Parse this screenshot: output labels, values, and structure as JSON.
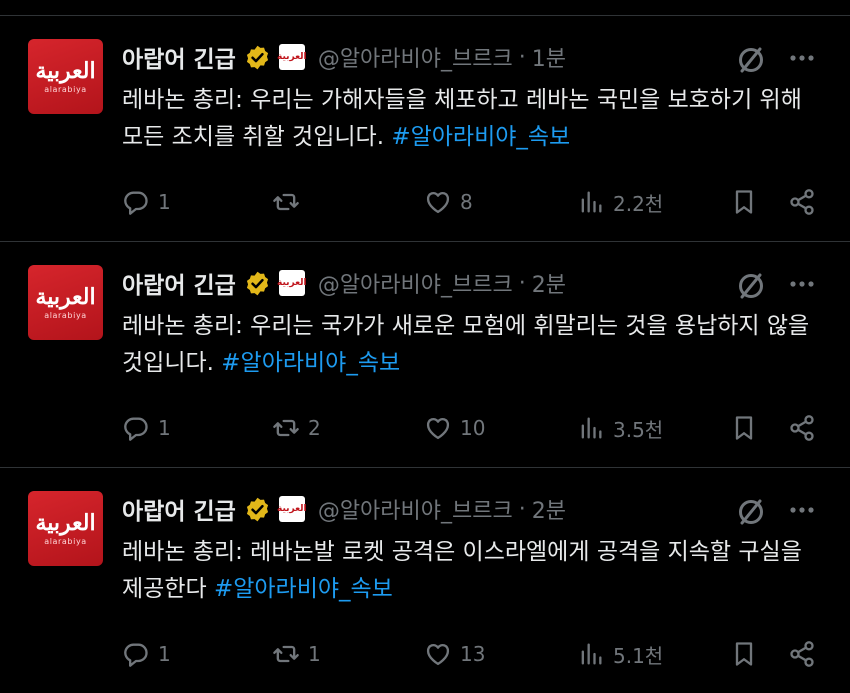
{
  "account": {
    "name": "아랍어 긴급",
    "handle": "@알아라비야_브르크",
    "avatar_text_ar": "العربية",
    "avatar_text_en": "alarabiya",
    "affiliate_badge_text": "العربية",
    "verified_color": "#e2b719",
    "avatar_color": "#d6252c"
  },
  "colors": {
    "background": "#000000",
    "text": "#e7e9ea",
    "muted": "#71767b",
    "link": "#1d9bf0"
  },
  "separator": "·",
  "tweets": [
    {
      "time": "1분",
      "text": "레바논 총리: 우리는 가해자들을 체포하고 레바논 국민을 보호하기 위해 모든 조치를 취할 것입니다.",
      "hashtag": "#알아라비야_속보",
      "replies": "1",
      "retweets": "",
      "likes": "8",
      "views": "2.2천"
    },
    {
      "time": "2분",
      "text": "레바논 총리: 우리는 국가가 새로운 모험에 휘말리는 것을 용납하지 않을 것입니다.",
      "hashtag": "#알아라비야_속보",
      "replies": "1",
      "retweets": "2",
      "likes": "10",
      "views": "3.5천"
    },
    {
      "time": "2분",
      "text": "레바논 총리: 레바논발 로켓 공격은 이스라엘에게 공격을 지속할 구실을 제공한다",
      "hashtag": "#알아라비야_속보",
      "replies": "1",
      "retweets": "1",
      "likes": "13",
      "views": "5.1천"
    }
  ],
  "icons": [
    "reply-icon",
    "retweet-icon",
    "like-icon",
    "views-icon",
    "bookmark-icon",
    "share-icon",
    "grok-icon",
    "more-icon",
    "verified-icon"
  ]
}
